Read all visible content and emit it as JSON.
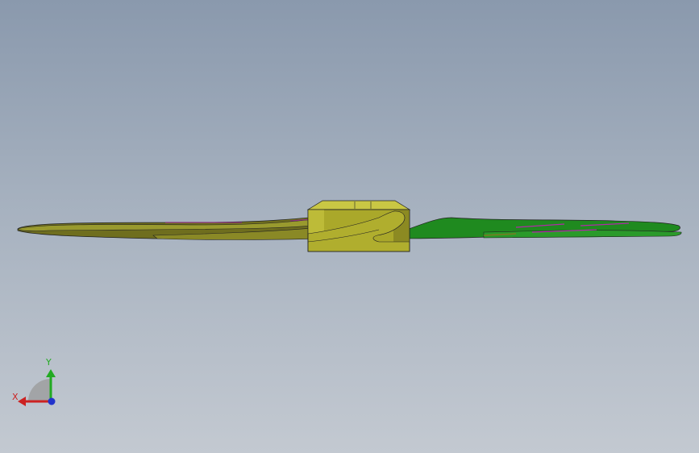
{
  "viewport": {
    "background_top": "#8a99ad",
    "background_bottom": "#c3c9d1"
  },
  "model": {
    "part": "propeller",
    "hub_color": "#a8a628",
    "blade_left_color": "#8c8c28",
    "blade_right_color": "#1f8a1f",
    "edge_highlight_color": "#b02aa8"
  },
  "triad": {
    "x_label": "X",
    "y_label": "Y",
    "x_color": "#cc2222",
    "y_color": "#22aa22",
    "z_color": "#2233cc"
  }
}
